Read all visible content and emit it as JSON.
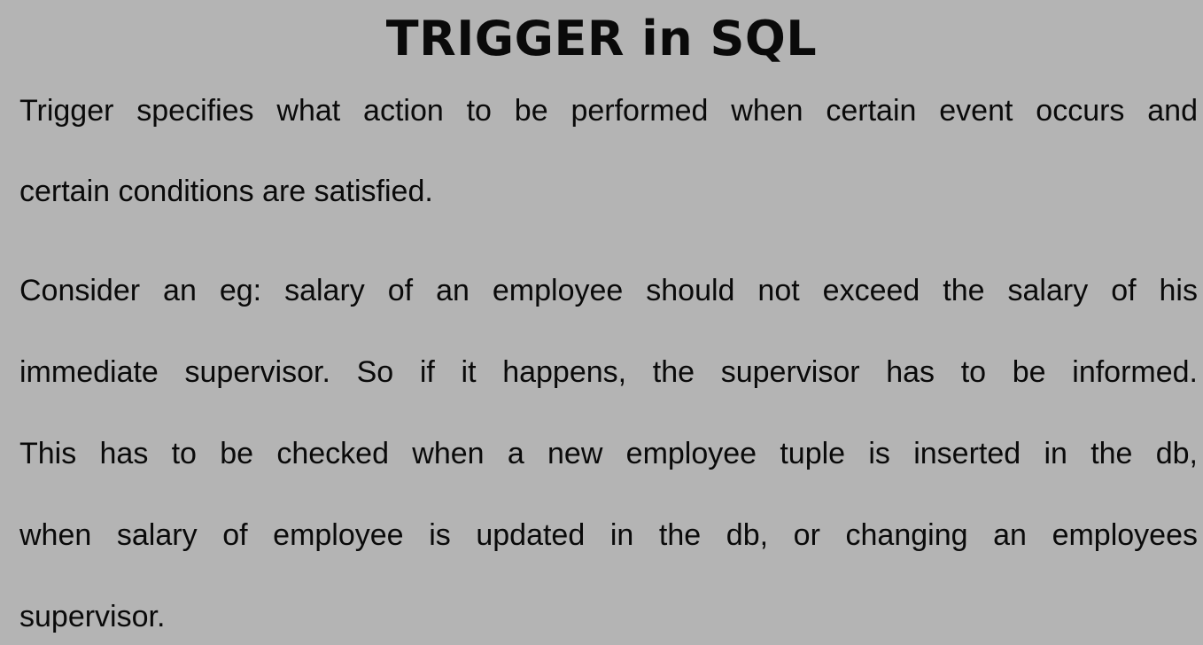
{
  "slide": {
    "title": "TRIGGER in SQL",
    "paragraph1": {
      "line1": "Trigger specifies what action to be performed when certain event occurs and",
      "line2": "certain conditions are satisfied."
    },
    "paragraph2": {
      "line1": "Consider an eg: salary of an employee should not exceed the salary of his",
      "line2": "immediate supervisor. So if it happens, the supervisor has to be informed.",
      "line3": "This has to be checked when a new employee tuple is inserted in the db,",
      "line4": "when salary of employee is updated in the db, or changing an employees",
      "line5": "supervisor."
    }
  }
}
